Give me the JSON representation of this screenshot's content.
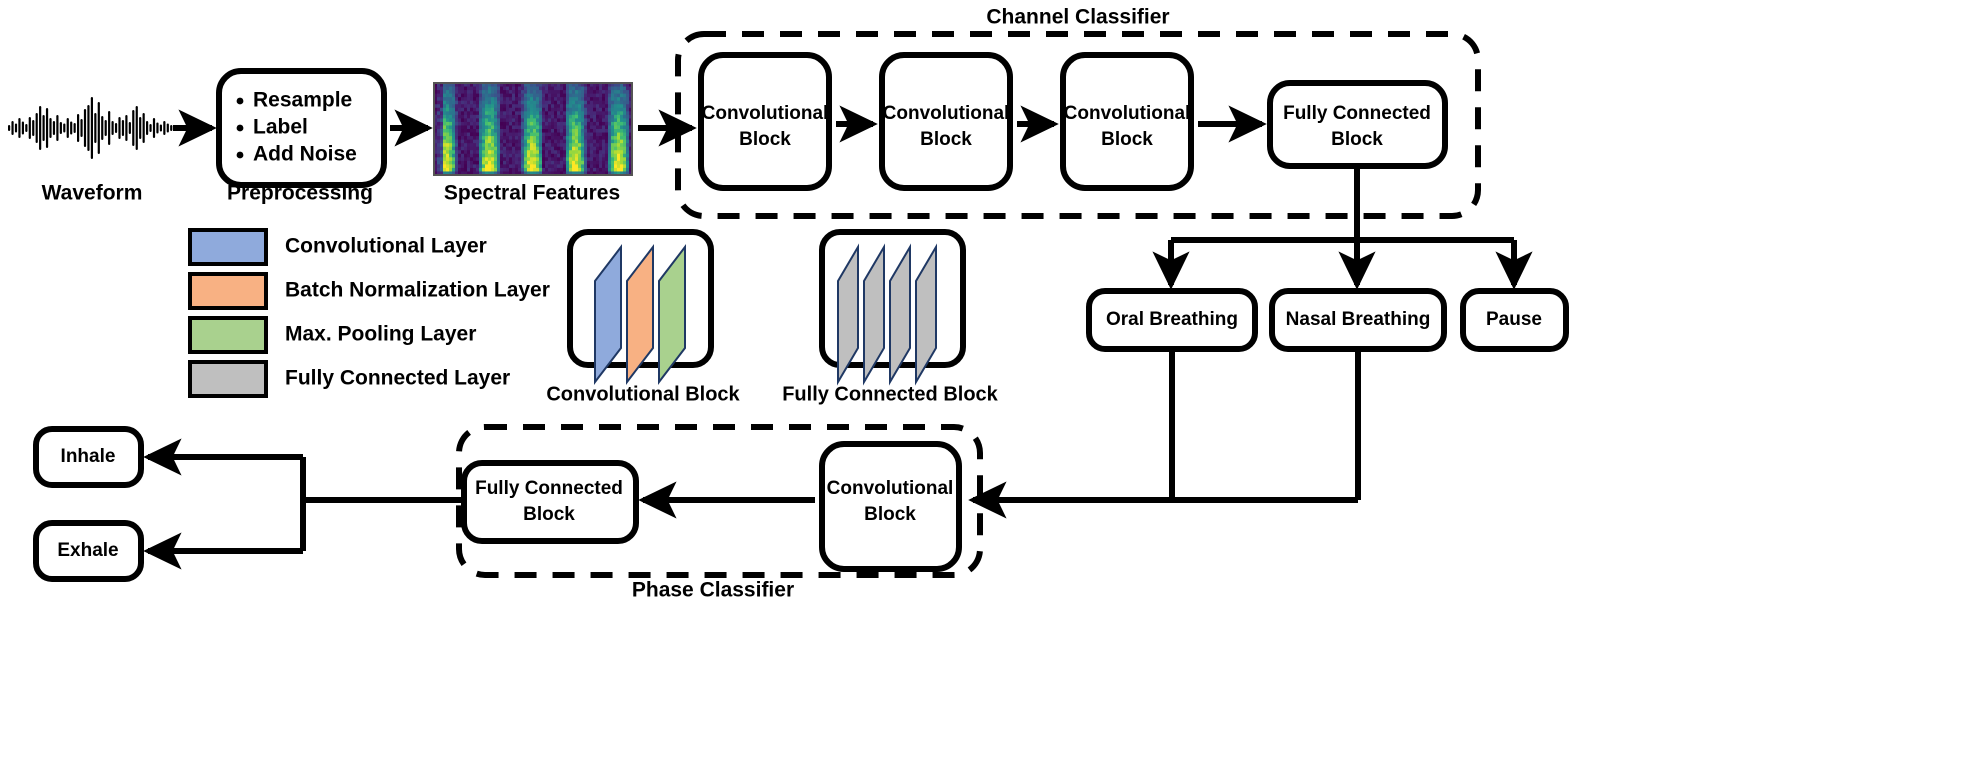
{
  "figure": {
    "type": "architecture-diagram",
    "background": "#FFFFFF"
  },
  "colors": {
    "conv_layer": "#8FAADC",
    "batchnorm_layer": "#F8B183",
    "maxpool_layer": "#A9D18E",
    "fc_layer": "#BFBFBF",
    "stroke": "#000000",
    "sheet_edge": "#1F3864"
  },
  "waveform": {
    "caption": "Waveform",
    "bars": [
      6,
      14,
      9,
      20,
      13,
      8,
      22,
      16,
      30,
      44,
      26,
      40,
      20,
      14,
      26,
      12,
      9,
      20,
      13,
      10,
      28,
      18,
      38,
      46,
      62,
      30,
      52,
      24,
      16,
      34,
      14,
      10,
      22,
      16,
      26,
      12,
      36,
      44,
      22,
      30,
      14,
      8,
      20,
      11,
      7,
      14,
      9,
      6
    ]
  },
  "preprocessing": {
    "caption": "Preprocessing",
    "items": [
      "Resample",
      "Label",
      "Add Noise"
    ]
  },
  "spectrogram": {
    "caption": "Spectral Features"
  },
  "channel_classifier": {
    "label": "Channel Classifier",
    "blocks": [
      {
        "lines": [
          "Convolutional",
          "Block"
        ],
        "name": "conv-block-1"
      },
      {
        "lines": [
          "Convolutional",
          "Block"
        ],
        "name": "conv-block-2"
      },
      {
        "lines": [
          "Convolutional",
          "Block"
        ],
        "name": "conv-block-3"
      },
      {
        "lines": [
          "Fully Connected",
          "Block"
        ],
        "name": "fc-block-1"
      }
    ]
  },
  "channel_outputs": [
    {
      "label": "Oral Breathing"
    },
    {
      "label": "Nasal Breathing"
    },
    {
      "label": "Pause"
    }
  ],
  "phase_classifier": {
    "label": "Phase Classifier",
    "blocks": [
      {
        "lines": [
          "Convolutional",
          "Block"
        ],
        "name": "phase-conv-block"
      },
      {
        "lines": [
          "Fully Connected",
          "Block"
        ],
        "name": "phase-fc-block"
      }
    ]
  },
  "phase_outputs": [
    {
      "label": "Inhale"
    },
    {
      "label": "Exhale"
    }
  ],
  "legend": {
    "items": [
      {
        "label": "Convolutional  Layer",
        "color": "#8FAADC"
      },
      {
        "label": "Batch Normalization Layer",
        "color": "#F8B183"
      },
      {
        "label": "Max. Pooling Layer",
        "color": "#A9D18E"
      },
      {
        "label": "Fully Connected Layer",
        "color": "#BFBFBF"
      }
    ]
  },
  "block_illustrations": [
    {
      "caption": "Convolutional Block",
      "sheets": [
        "#8FAADC",
        "#F8B183",
        "#A9D18E"
      ]
    },
    {
      "caption": "Fully Connected Block",
      "sheets": [
        "#BFBFBF",
        "#BFBFBF",
        "#BFBFBF",
        "#BFBFBF"
      ]
    }
  ]
}
